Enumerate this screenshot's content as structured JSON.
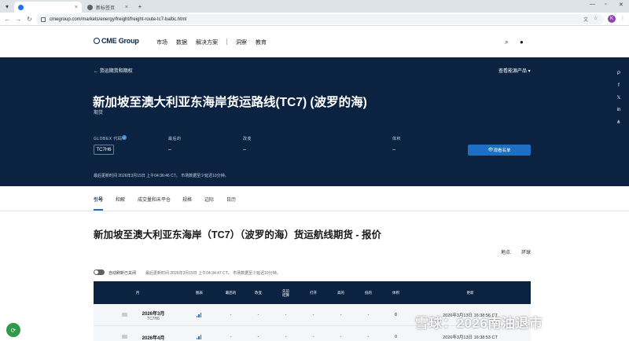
{
  "browser": {
    "tabs": [
      {
        "label": "",
        "active": true
      },
      {
        "label": "新标签页",
        "active": false
      }
    ],
    "url": "cmegroup.com/markets/energy/freight/freight-route-tc7-baltic.html",
    "profile_initial": "K"
  },
  "header": {
    "logo": "CME Group",
    "nav": [
      "市场",
      "数据",
      "解决方案",
      "洞察",
      "教育"
    ]
  },
  "hero": {
    "back_link": "货运期货和期权",
    "view_energy": "查看能源产品",
    "title": "新加坡至澳大利亚东海岸货运路线(TC7) (波罗的海)",
    "subtitle": "期货",
    "fields": [
      {
        "label": "GLOBEX 代码",
        "value": "TC7H6"
      },
      {
        "label": "最后的",
        "value": "–"
      },
      {
        "label": "改变",
        "value": "–"
      },
      {
        "label": "体积",
        "value": "–"
      }
    ],
    "watchlist_button": "观看名单",
    "note": "最后更新时间 2026年3月15日 上午04:36:46 CT。  市场数据至少延迟10分钟。"
  },
  "subtabs": [
    "引号",
    "和解",
    "成交量和未平仓",
    "规格",
    "边际",
    "日历"
  ],
  "content": {
    "title": "新加坡至澳大利亚东海岸（TC7）（波罗的海）货运航线期货 - 报价",
    "location_label": "地点:",
    "location_value": "环球",
    "toggle_label": "自动刷新已关闭",
    "last_update": "最后更新时间 2026年3月15日 上午04:34:47 CT。  市场数据至少延迟10分钟。"
  },
  "table": {
    "headers": [
      "月",
      "图表",
      "最后的",
      "改变",
      "先前\n结算",
      "打开",
      "高的",
      "低的",
      "体积",
      "更新"
    ],
    "rows": [
      {
        "month": "2026年3月",
        "code": "TC7H6",
        "last": "-",
        "change": "-",
        "prior": "-",
        "open": "-",
        "high": "-",
        "low": "-",
        "volume": "0",
        "updated": "2026年3月13日 16:38:56 CT"
      },
      {
        "month": "2026年4月",
        "code": "",
        "last": "-",
        "change": "-",
        "prior": "-",
        "open": "-",
        "high": "-",
        "low": "-",
        "volume": "0",
        "updated": "2026年3月13日 16:38:53 CT"
      }
    ]
  },
  "watermark": "雪球：2026南油退市",
  "colors": {
    "hero_bg": "#0b2341",
    "accent": "#1d6fc4"
  }
}
